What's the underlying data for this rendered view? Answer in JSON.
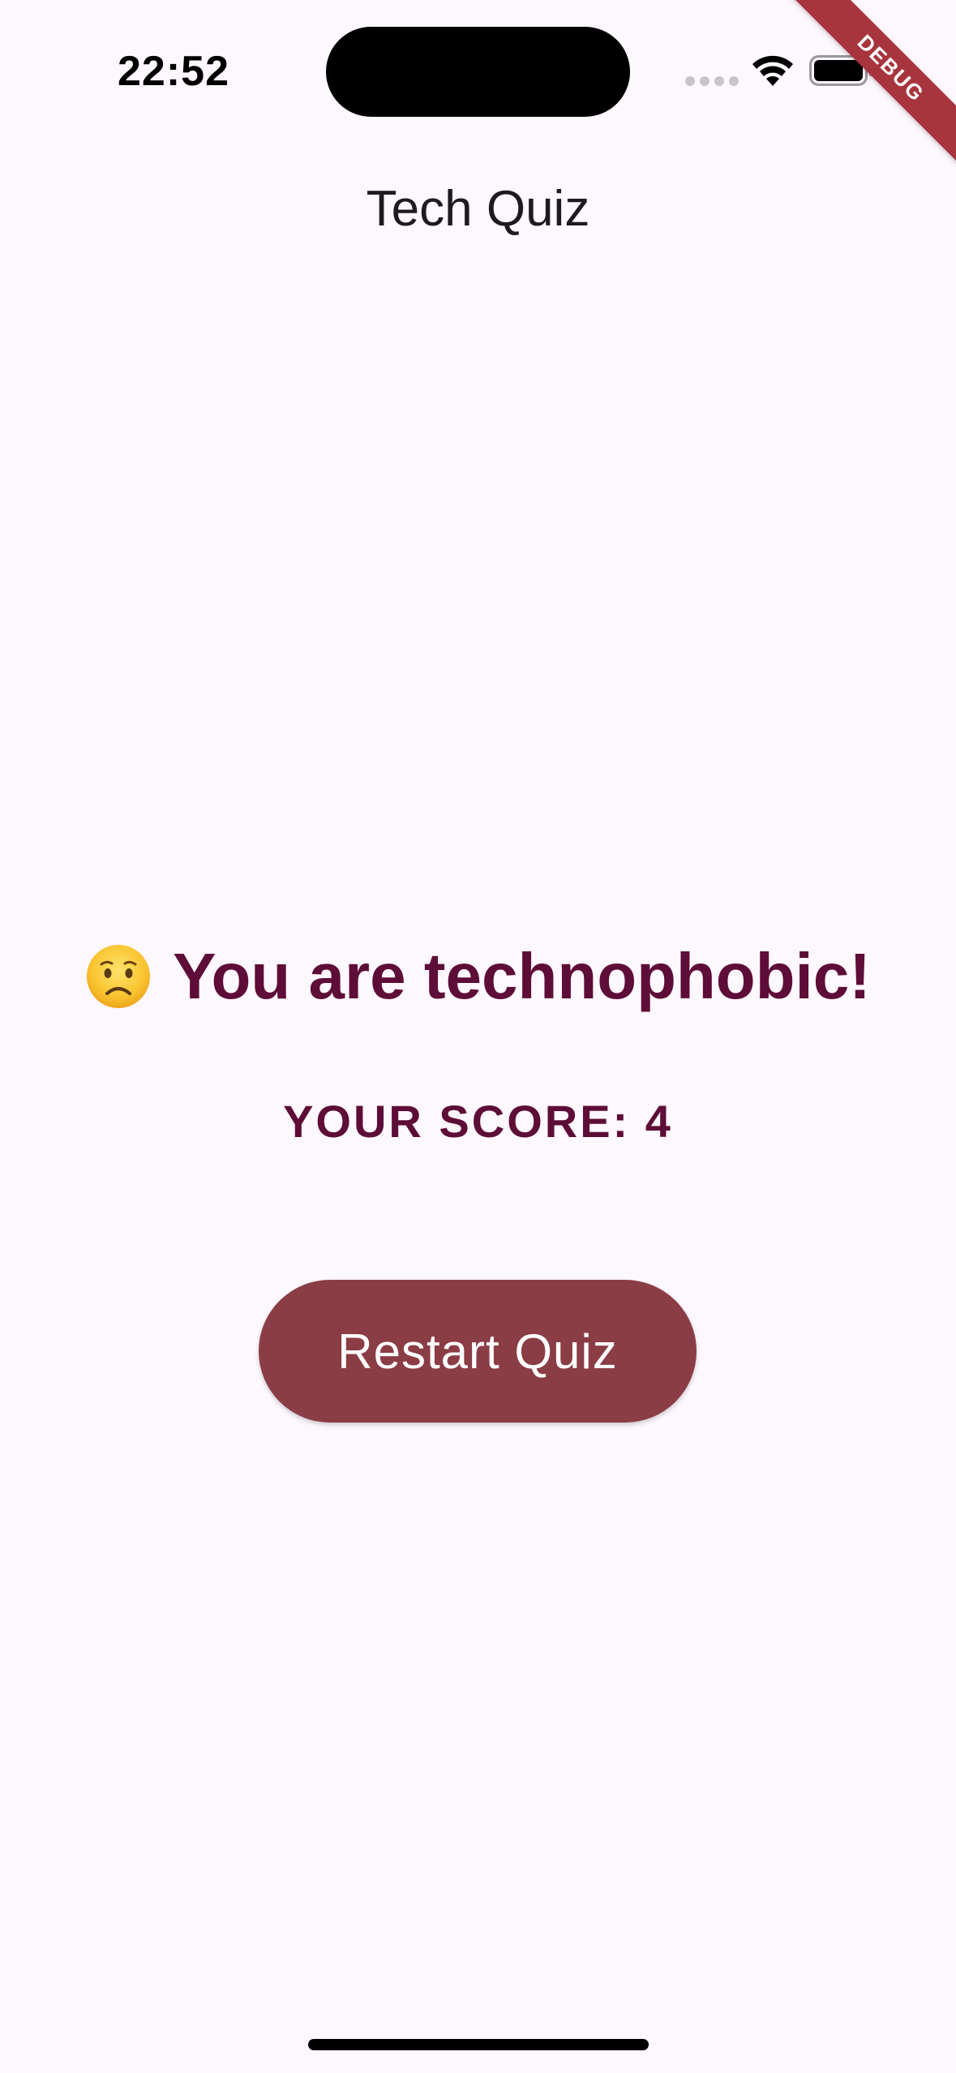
{
  "status_bar": {
    "time": "22:52"
  },
  "debug_banner": {
    "label": "DEBUG",
    "color": "#a8353e"
  },
  "app_bar": {
    "title": "Tech Quiz"
  },
  "result": {
    "emoji_icon": "worried-face-icon",
    "message": "You are technophobic!",
    "score_label": "YOUR SCORE: 4"
  },
  "actions": {
    "restart_label": "Restart Quiz"
  },
  "colors": {
    "background": "#fdf7fe",
    "text_primary": "#5d0d37",
    "button_bg": "#8b3d45",
    "button_text": "#ffffff"
  }
}
